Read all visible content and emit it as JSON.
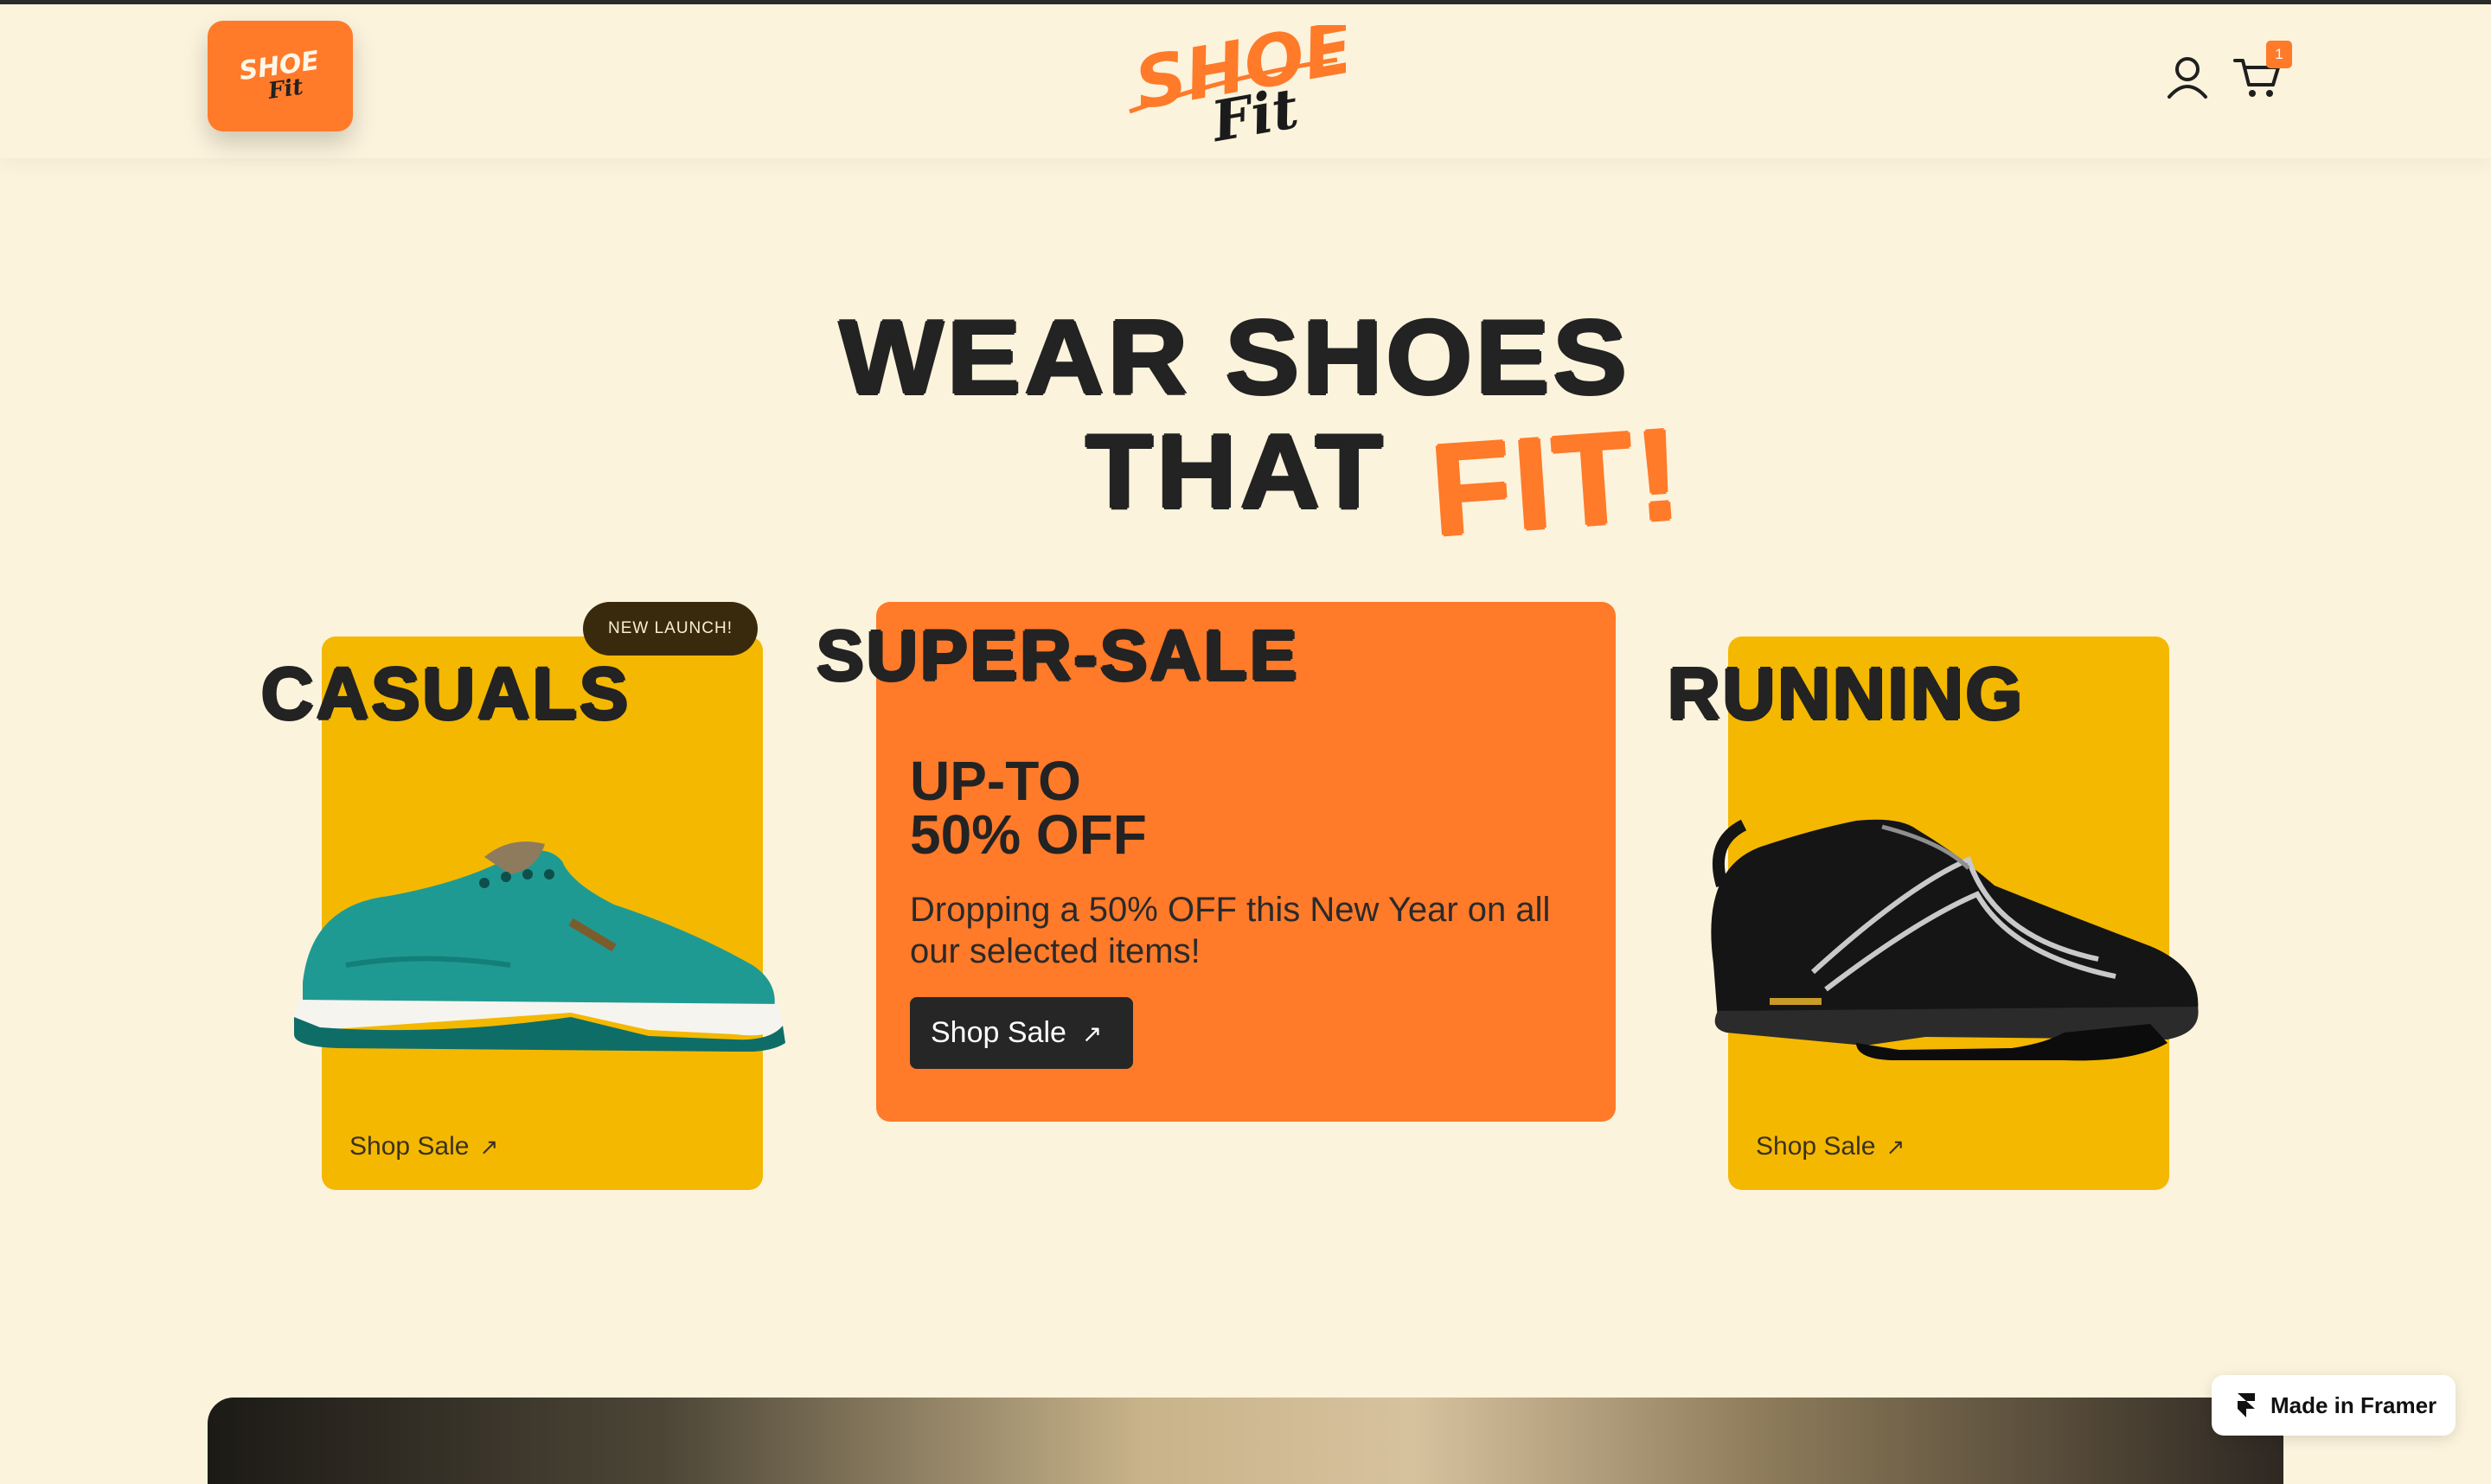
{
  "header": {
    "brand_line1": "SHOE",
    "brand_line2": "Fit",
    "cart_count": "1"
  },
  "hero": {
    "line1": "WEAR SHOES",
    "line2": "THAT",
    "accent": "FIT!"
  },
  "cards": {
    "casuals": {
      "title": "CASUALS",
      "badge": "NEW LAUNCH!",
      "link": "Shop Sale",
      "arrow": "↗"
    },
    "supersale": {
      "title": "SUPER-SALE",
      "headline_line1": "UP-TO",
      "headline_line2": "50% OFF",
      "description": "Dropping a 50% OFF this New Year on all our selected items!",
      "button": "Shop Sale",
      "arrow": "↗"
    },
    "running": {
      "title": "RUNNING",
      "link": "Shop Sale",
      "arrow": "↗"
    }
  },
  "framer_badge": {
    "label": "Made in Framer"
  },
  "colors": {
    "background": "#fbf3dc",
    "accent_orange": "#ff7a29",
    "card_yellow": "#f4b800",
    "dark": "#232323"
  }
}
